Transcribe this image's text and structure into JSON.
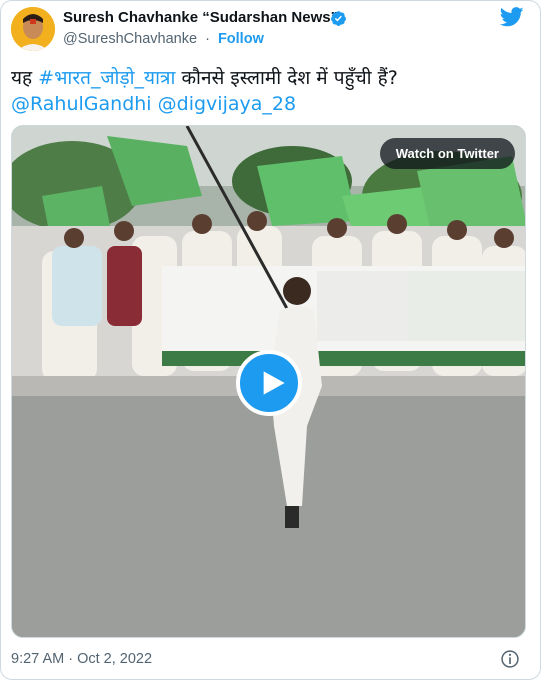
{
  "author": {
    "display_name": "Suresh Chavhanke “Sudarshan News”",
    "handle": "@SureshChavhanke",
    "separator": "·",
    "follow_label": "Follow",
    "verified": true
  },
  "tweet": {
    "text_prefix": "यह ",
    "hashtag": "#भारत_जोड़ो_यात्रा",
    "text_rest": " कौनसे इस्लामी देश में पहुँची हैं?",
    "mention_1": "@RahulGandhi",
    "mention_2": "@digvijaya_28"
  },
  "media": {
    "watch_label": "Watch on Twitter",
    "play_icon": "play-icon"
  },
  "footer": {
    "timestamp": "9:27 AM · Oct 2, 2022",
    "info_icon": "info-icon"
  },
  "colors": {
    "accent": "#1d9bf0",
    "text": "#0f1419",
    "secondary": "#536471",
    "border": "#cfd9de"
  }
}
